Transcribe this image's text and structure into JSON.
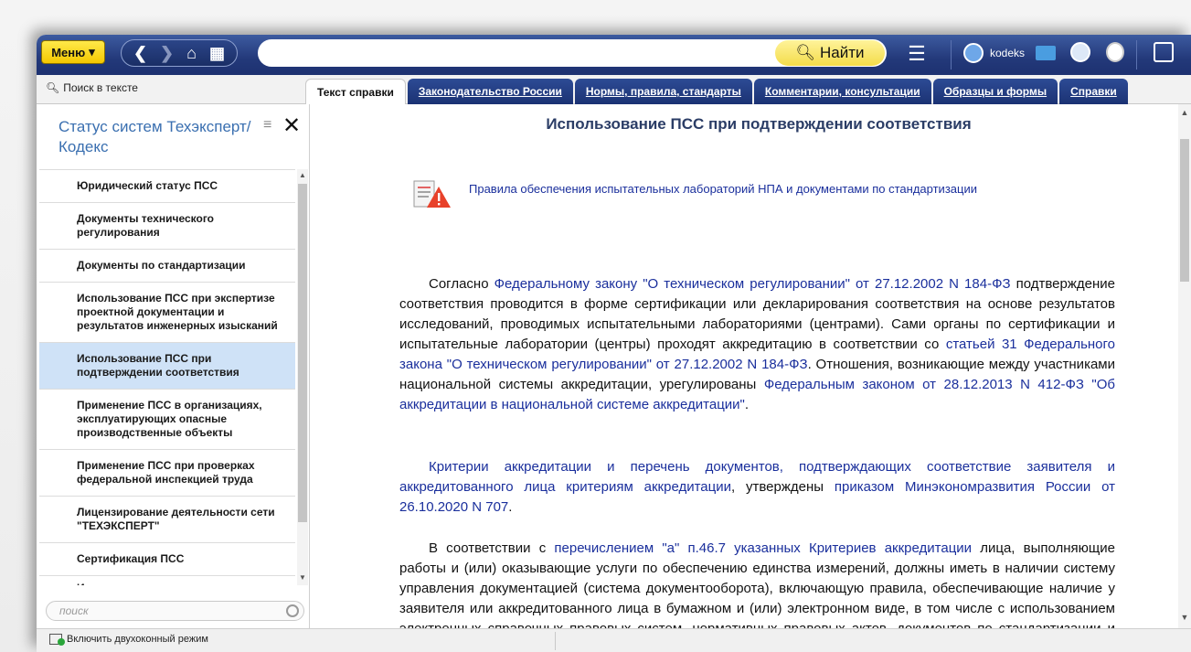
{
  "toolbar": {
    "menu_label": "Меню",
    "find_label": "Найти",
    "username": "kodeks"
  },
  "search_in_text": "Поиск в тексте",
  "tabs": [
    {
      "label": "Текст справки",
      "active": true
    },
    {
      "label": "Законодательство России",
      "active": false
    },
    {
      "label": "Нормы, правила, стандарты",
      "active": false
    },
    {
      "label": "Комментарии, консультации",
      "active": false
    },
    {
      "label": "Образцы и формы",
      "active": false
    },
    {
      "label": "Справки",
      "active": false
    }
  ],
  "sidebar": {
    "title": "Статус систем Техэксперт/Кодекс",
    "search_placeholder": "поиск",
    "items": [
      {
        "label": "Юридический статус ПСС"
      },
      {
        "label": "Документы технического регулирования"
      },
      {
        "label": "Документы по стандартизации"
      },
      {
        "label": "Использование ПСС при экспертизе проектной документации и результатов инженерных изысканий"
      },
      {
        "label": "Использование ПСС при подтверждении соответствия"
      },
      {
        "label": "Применение ПСС в организациях, эксплуатирующих опасные производственные объекты"
      },
      {
        "label": "Применение ПСС при проверках федеральной инспекцией труда"
      },
      {
        "label": "Лицензирование деятельности сети \"ТЕХЭКСПЕРТ\""
      },
      {
        "label": "Сертификация ПСС"
      },
      {
        "label": "Исключительное право на"
      }
    ]
  },
  "content": {
    "title": "Использование ПСС при подтверждении соответствия",
    "warning_link": "Правила обеспечения испытательных лабораторий НПА и документами по стандартизации",
    "p1": {
      "t1": "Согласно ",
      "l1": "Федеральному закону \"О техническом регулировании\" от 27.12.2002 N 184-ФЗ",
      "t2": " подтверждение соответствия проводится в форме сертификации или декларирования соответствия на основе результатов исследований, проводимых испытательными лабораториями (центрами). Сами органы по сертификации и испытательные лаборатории (центры) проходят аккредитацию в соответствии со ",
      "l2": "статьей 31 Федерального закона \"О техническом регулировании\" от 27.12.2002 N 184-ФЗ",
      "t3": ". Отношения, возникающие между участниками национальной системы аккредитации, урегулированы ",
      "l3": "Федеральным законом от 28.12.2013 N 412-ФЗ \"Об аккредитации в национальной системе аккредитации\"",
      "t4": "."
    },
    "p2": {
      "l1": "Критерии аккредитации и перечень документов, подтверждающих соответствие заявителя и аккредитованного лица критериям аккредитации",
      "t1": ", утверждены ",
      "l2": "приказом Минэкономразвития России от 26.10.2020 N 707",
      "t2": "."
    },
    "p3": {
      "t1": "В соответствии с ",
      "l1": "перечислением \"а\" п.46.7 указанных Критериев аккредитации",
      "t2": " лица, выполняющие работы и (или) оказывающие услуги по обеспечению единства измерений, должны иметь в наличии систему управления документацией (система документооборота), включающую правила, обеспечивающие наличие у заявителя или аккредитованного лица в бумажном и (или) электронном виде, в том числе с использованием электронных справочных правовых систем, нормативных правовых актов, документов по стандартизации и иных документов, устанавливающих требования к работам"
    }
  },
  "statusbar": {
    "two_window_label": "Включить двухоконный режим"
  }
}
